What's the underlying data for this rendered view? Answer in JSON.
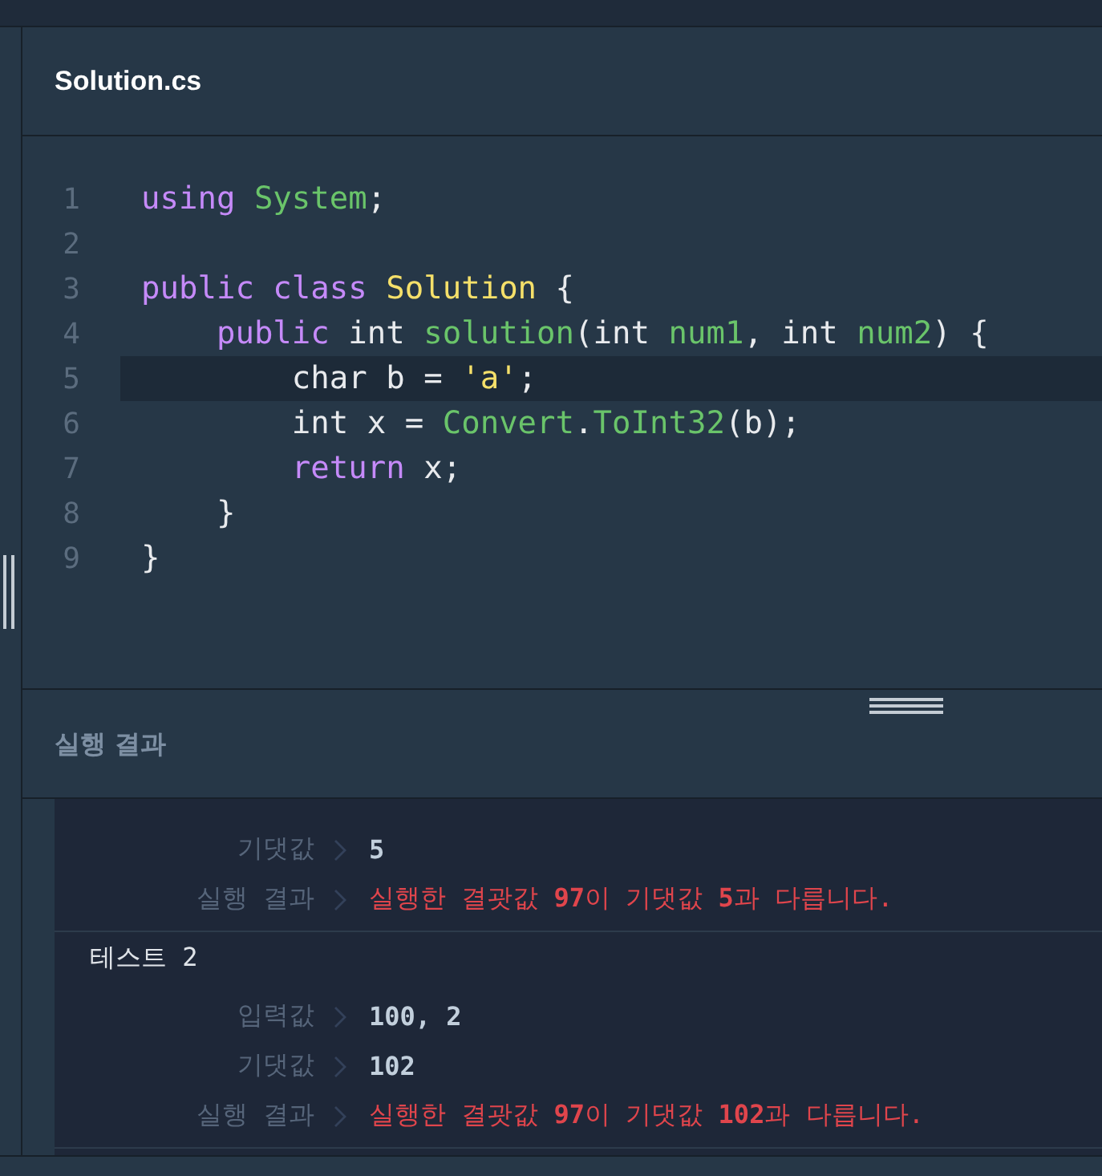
{
  "file_tab": {
    "title": "Solution.cs"
  },
  "editor": {
    "lines": [
      {
        "number": "1",
        "current": false,
        "tokens": [
          {
            "kind": "kw",
            "text": "using"
          },
          {
            "kind": "name",
            "text": " System"
          },
          {
            "kind": "plain",
            "text": ";"
          }
        ]
      },
      {
        "number": "2",
        "current": false
      },
      {
        "number": "3",
        "current": false,
        "tokens": [
          {
            "kind": "kw",
            "text": "public class"
          },
          {
            "kind": "type",
            "text": " Solution"
          },
          {
            "kind": "plain",
            "text": " {"
          }
        ]
      },
      {
        "number": "4",
        "current": false,
        "tokens": [
          {
            "kind": "kw",
            "text": "    public"
          },
          {
            "kind": "plain",
            "text": " int "
          },
          {
            "kind": "name",
            "text": "solution"
          },
          {
            "kind": "plain",
            "text": "(int "
          },
          {
            "kind": "name",
            "text": "num1"
          },
          {
            "kind": "plain",
            "text": ", int "
          },
          {
            "kind": "name",
            "text": "num2"
          },
          {
            "kind": "plain",
            "text": ") {"
          }
        ]
      },
      {
        "number": "5",
        "current": true,
        "tokens": [
          {
            "kind": "plain",
            "text": "        char b = "
          },
          {
            "kind": "str",
            "text": "'a'"
          },
          {
            "kind": "plain",
            "text": ";"
          }
        ]
      },
      {
        "number": "6",
        "current": false,
        "tokens": [
          {
            "kind": "plain",
            "text": "        int x = "
          },
          {
            "kind": "name",
            "text": "Convert"
          },
          {
            "kind": "plain",
            "text": "."
          },
          {
            "kind": "name",
            "text": "ToInt32"
          },
          {
            "kind": "plain",
            "text": "(b);"
          }
        ]
      },
      {
        "number": "7",
        "current": false,
        "tokens": [
          {
            "kind": "kw",
            "text": "        return"
          },
          {
            "kind": "plain",
            "text": " x;"
          }
        ]
      },
      {
        "number": "8",
        "current": false,
        "tokens": [
          {
            "kind": "plain",
            "text": "    }"
          }
        ]
      },
      {
        "number": "9",
        "current": false,
        "tokens": [
          {
            "kind": "plain",
            "text": "}"
          }
        ]
      }
    ]
  },
  "results": {
    "title": "실행 결과",
    "tests": [
      {
        "rows": [
          {
            "kind": "value",
            "label": "기댓값",
            "value": "5"
          },
          {
            "kind": "message",
            "label": "실행 결과",
            "value": "실행한 결괏값 **97**이 기댓값 **5**과 다릅니다."
          }
        ]
      },
      {
        "title": "테스트 2",
        "rows": [
          {
            "kind": "value",
            "label": "입력값",
            "value": "100, 2"
          },
          {
            "kind": "value",
            "label": "기댓값",
            "value": "102"
          },
          {
            "kind": "message",
            "label": "실행 결과",
            "value": "실행한 결괏값 **97**이 기댓값 **102**과 다릅니다."
          }
        ]
      }
    ]
  }
}
